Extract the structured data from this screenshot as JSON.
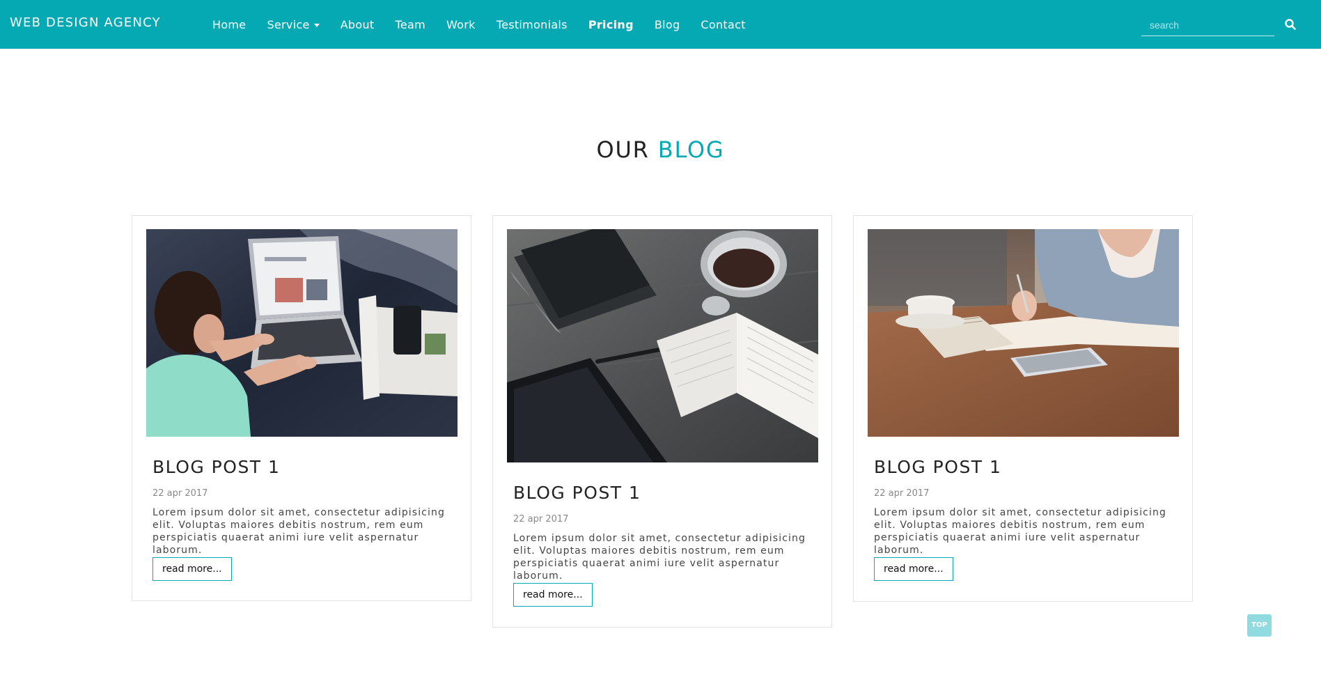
{
  "navbar": {
    "brand": "WEB DESIGN AGENCY",
    "items": [
      {
        "label": "Home"
      },
      {
        "label": "Service"
      },
      {
        "label": "About"
      },
      {
        "label": "Team"
      },
      {
        "label": "Work"
      },
      {
        "label": "Testimonials"
      },
      {
        "label": "Pricing"
      },
      {
        "label": "Blog"
      },
      {
        "label": "Contact"
      }
    ],
    "search_placeholder": "search",
    "search_icon": "search-icon"
  },
  "section": {
    "title_main": "OUR ",
    "title_accent": "BLOG"
  },
  "posts": [
    {
      "title": "BLOG POST 1",
      "date": "22 apr 2017",
      "text": "Lorem ipsum dolor sit amet, consectetur adipisicing elit. Voluptas maiores debitis nostrum, rem eum perspiciatis quaerat animi iure velit aspernatur laborum.",
      "button": "read more..."
    },
    {
      "title": "BLOG POST 1",
      "date": "22 apr 2017",
      "text": "Lorem ipsum dolor sit amet, consectetur adipisicing elit. Voluptas maiores debitis nostrum, rem eum perspiciatis quaerat animi iure velit aspernatur laborum.",
      "button": "read more..."
    },
    {
      "title": "BLOG POST 1",
      "date": "22 apr 2017",
      "text": "Lorem ipsum dolor sit amet, consectetur adipisicing elit. Voluptas maiores debitis nostrum, rem eum perspiciatis quaerat animi iure velit aspernatur laborum.",
      "button": "read more..."
    }
  ],
  "top_button": "TOP",
  "colors": {
    "accent": "#04a9b4",
    "top_button": "#8fdbe0"
  }
}
